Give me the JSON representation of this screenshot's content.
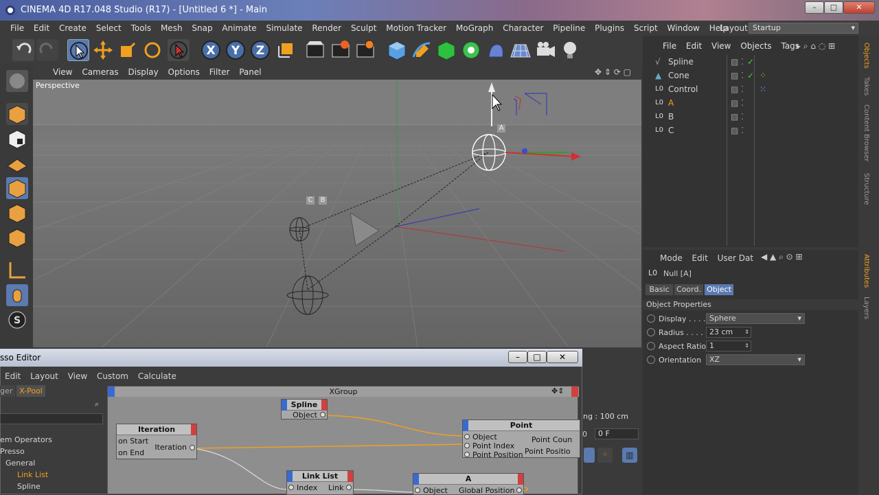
{
  "window": {
    "title": "CINEMA 4D R17.048 Studio (R17) - [Untitled 6 *] - Main"
  },
  "menu": [
    "File",
    "Edit",
    "Create",
    "Select",
    "Tools",
    "Mesh",
    "Snap",
    "Animate",
    "Simulate",
    "Render",
    "Sculpt",
    "Motion Tracker",
    "MoGraph",
    "Character",
    "Pipeline",
    "Plugins",
    "Script",
    "Window",
    "Help"
  ],
  "layout": {
    "label": "Layout:",
    "value": "Startup"
  },
  "viewport": {
    "menu": [
      "View",
      "Cameras",
      "Display",
      "Options",
      "Filter",
      "Panel"
    ],
    "label": "Perspective",
    "obj_labels": [
      "A",
      "B",
      "C"
    ],
    "grid_spacing": "ing : 100 cm"
  },
  "objects": {
    "menu": [
      "File",
      "Edit",
      "View",
      "Objects",
      "Tags"
    ],
    "items": [
      {
        "name": "Spline"
      },
      {
        "name": "Cone"
      },
      {
        "name": "Control"
      },
      {
        "name": "A"
      },
      {
        "name": "B"
      },
      {
        "name": "C"
      }
    ]
  },
  "side_tabs_top": [
    "Objects",
    "Takes",
    "Content Browser",
    "Structure"
  ],
  "side_tabs_bottom": [
    "Attributes",
    "Layers"
  ],
  "attributes": {
    "menu": [
      "Mode",
      "Edit",
      "User Dat"
    ],
    "object_title": "Null [A]",
    "tabs": [
      "Basic",
      "Coord.",
      "Object"
    ],
    "section": "Object Properties",
    "display_label": "Display . . . .",
    "display_value": "Sphere",
    "radius_label": "Radius . . . .",
    "radius_value": "23 cm",
    "aspect_label": "Aspect Ratio",
    "aspect_value": "1",
    "orientation_label": "Orientation",
    "orientation_value": "XZ"
  },
  "timeline": {
    "frame_value": "0 F",
    "left_num": "0"
  },
  "xpresso": {
    "title": "sso Editor",
    "menu": [
      "Edit",
      "Layout",
      "View",
      "Custom",
      "Calculate"
    ],
    "tabs": [
      "ger",
      "X-Pool"
    ],
    "tree": [
      "em Operators",
      "Presso",
      "General",
      "Link List",
      "Spline"
    ],
    "group_title": "XGroup",
    "nodes": {
      "spline": {
        "title": "Spline",
        "out": "Object"
      },
      "iteration": {
        "title": "Iteration",
        "in1": "on Start",
        "in2": "on End",
        "out": "Iteration"
      },
      "point": {
        "title": "Point",
        "in1": "Object",
        "in2": "Point Index",
        "in3": "Point Position",
        "out1": "Point Coun",
        "out2": "Point Positio"
      },
      "linklist": {
        "title": "Link List",
        "in": "Index",
        "out": "Link"
      },
      "a": {
        "title": "A",
        "in": "Object",
        "out": "Global Position"
      }
    }
  }
}
